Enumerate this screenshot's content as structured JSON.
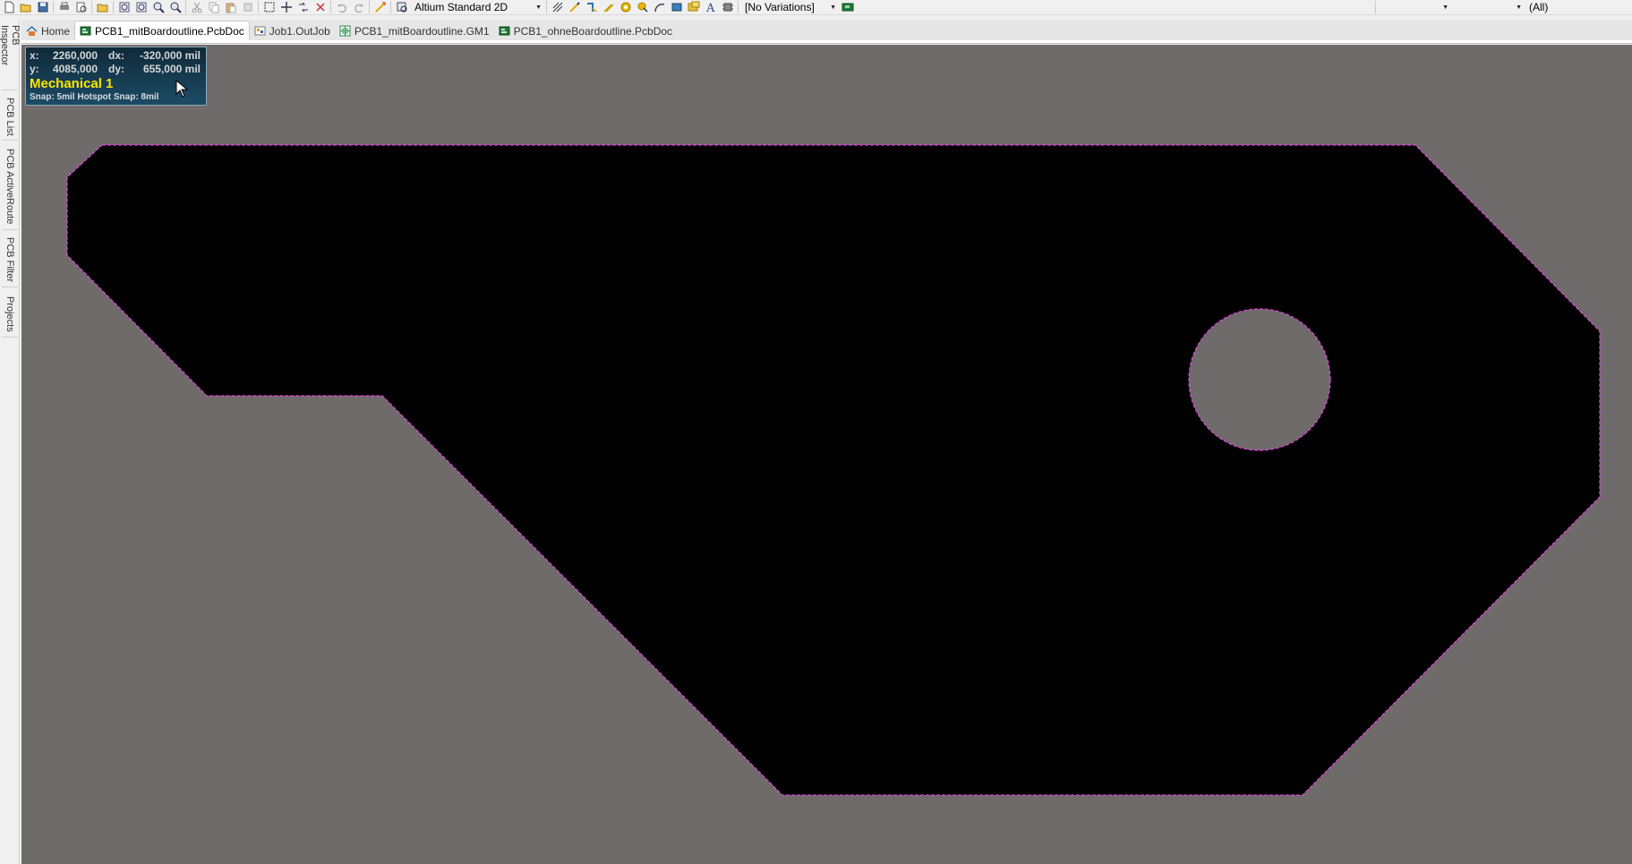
{
  "toolbar": {
    "view_mode": "Altium Standard 2D",
    "variations": "[No Variations]",
    "filter_right": "(All)",
    "icons": [
      "new-file-icon",
      "open-folder-icon",
      "save-icon",
      "print-icon",
      "print-preview-icon",
      "open-project-icon",
      "zoom-fit-icon",
      "zoom-area-icon",
      "zoom-selected-icon",
      "zoom-filter-icon",
      "cut-icon",
      "copy-icon",
      "paste-icon",
      "rubber-stamp-icon",
      "select-area-icon",
      "move-icon",
      "cross-probe-icon",
      "clear-selection-icon",
      "undo-icon",
      "redo-icon",
      "route-icon",
      "inspect-icon"
    ],
    "place_icons": [
      "hatch-icon",
      "wire-icon",
      "interactive-route-icon",
      "diff-pair-icon",
      "via-icon",
      "pad-icon",
      "arc-icon",
      "fill-icon",
      "polygon-icon",
      "string-icon",
      "component-icon"
    ]
  },
  "tabs": [
    {
      "label": "Home",
      "icon": "home-icon",
      "active": false
    },
    {
      "label": "PCB1_mitBoardoutline.PcbDoc",
      "icon": "pcb-doc-icon",
      "active": true
    },
    {
      "label": "Job1.OutJob",
      "icon": "outjob-icon",
      "active": false
    },
    {
      "label": "PCB1_mitBoardoutline.GM1",
      "icon": "gerber-icon",
      "active": false
    },
    {
      "label": "PCB1_ohneBoardoutline.PcbDoc",
      "icon": "pcb-doc-icon",
      "active": false
    }
  ],
  "sidebar": {
    "panels": [
      "PCB Inspector",
      "PCB List",
      "PCB ActiveRoute",
      "PCB Filter",
      "Projects"
    ]
  },
  "hud": {
    "x_label": "x:",
    "x_value": "2260,000",
    "dx_label": "dx:",
    "dx_value": "-320,000 mil",
    "y_label": "y:",
    "y_value": "4085,000",
    "dy_label": "dy:",
    "dy_value": "655,000 mil",
    "layer": "Mechanical 1",
    "snap": "Snap: 5mil Hotspot Snap: 8mil"
  },
  "colors": {
    "canvas": "#706b6b",
    "board": "#000000",
    "outline": "#e040e0",
    "hud_layer": "#ffe600"
  }
}
